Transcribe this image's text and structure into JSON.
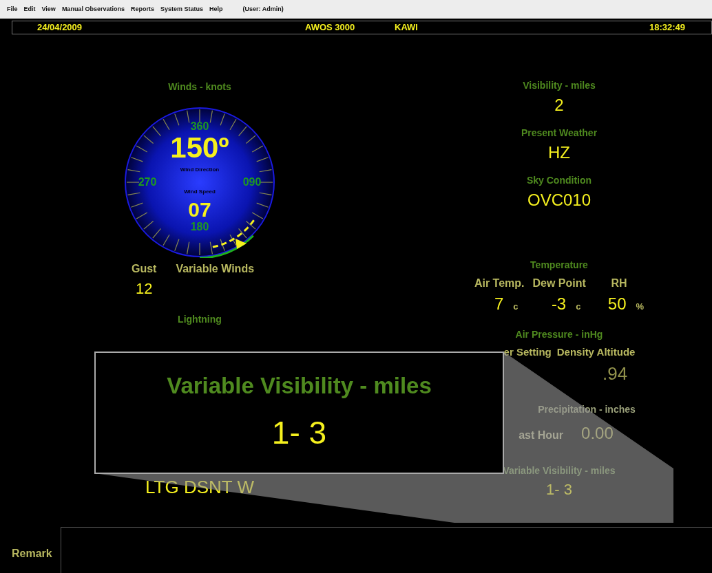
{
  "menu": [
    {
      "label": "File"
    },
    {
      "label": "Edit"
    },
    {
      "label": "View"
    },
    {
      "label": "Manual Observations"
    },
    {
      "label": "Reports"
    },
    {
      "label": "System Status"
    },
    {
      "label": "Help"
    }
  ],
  "user": "(User: Admin)",
  "header": {
    "date": "24/04/2009",
    "system": "AWOS 3000",
    "station": "KAWI",
    "time": "18:32:49"
  },
  "winds": {
    "title": "Winds - knots",
    "dial_labels": [
      "360",
      "090",
      "180",
      "270"
    ],
    "direction": "150º",
    "direction_caption": "Wind Direction",
    "speed_caption": "Wind Speed",
    "speed": "07",
    "gust_label": "Gust",
    "gust": "12",
    "variable_label": "Variable Winds"
  },
  "lightning": {
    "title": "Lightning",
    "value": "LTG DSNT W"
  },
  "visibility": {
    "title": "Visibility - miles",
    "value": "2"
  },
  "present_weather": {
    "title": "Present Weather",
    "value": "HZ"
  },
  "sky_condition": {
    "title": "Sky Condition",
    "value": "OVC010"
  },
  "temperature": {
    "title": "Temperature",
    "columns": [
      {
        "label": "Air Temp.",
        "value": "7",
        "unit": "c"
      },
      {
        "label": "Dew Point",
        "value": "-3",
        "unit": "c"
      },
      {
        "label": "RH",
        "value": "50",
        "unit": "%"
      }
    ]
  },
  "air_pressure": {
    "title": "Air Pressure - inHg",
    "labels": [
      "er Setting",
      "Density Altitude"
    ],
    "value": ".94"
  },
  "precipitation": {
    "title": "Precipitation - inches",
    "label": "ast Hour",
    "value": "0.00"
  },
  "variable_visibility": {
    "title": "Variable Visibility - miles",
    "value": "1- 3"
  },
  "callout": {
    "title": "Variable Visibility - miles",
    "value": "1- 3"
  },
  "remark": {
    "label": "Remark"
  }
}
